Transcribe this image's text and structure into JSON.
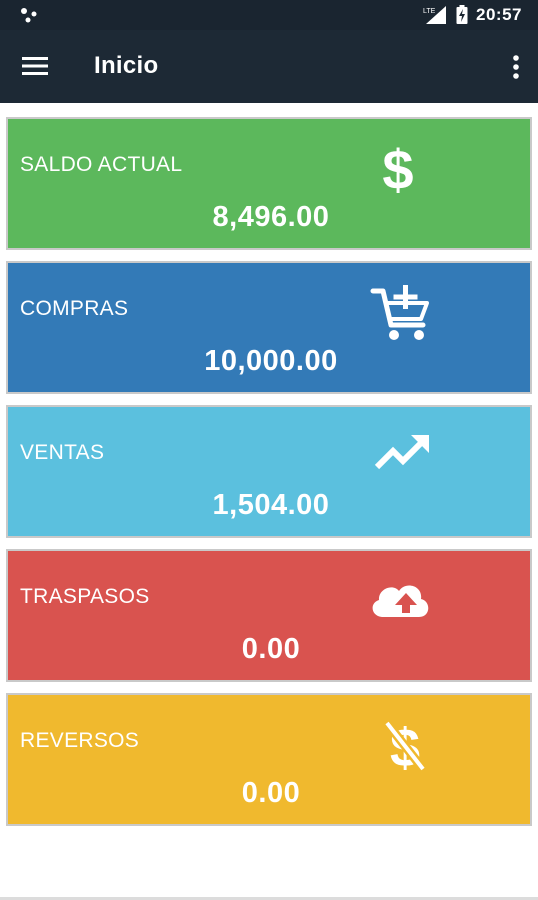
{
  "status_bar": {
    "network": "LTE",
    "time": "20:57"
  },
  "app_bar": {
    "title": "Inicio"
  },
  "cards": [
    {
      "label": "SALDO ACTUAL",
      "value": "8,496.00",
      "color": "#5cb85c",
      "icon": "dollar-icon"
    },
    {
      "label": "COMPRAS",
      "value": "10,000.00",
      "color": "#337ab7",
      "icon": "cart-add-icon"
    },
    {
      "label": "VENTAS",
      "value": "1,504.00",
      "color": "#5bc0de",
      "icon": "trending-up-icon"
    },
    {
      "label": "TRASPASOS",
      "value": "0.00",
      "color": "#d9534f",
      "icon": "cloud-upload-icon"
    },
    {
      "label": "REVERSOS",
      "value": "0.00",
      "color": "#f0b92e",
      "icon": "no-dollar-icon"
    }
  ]
}
